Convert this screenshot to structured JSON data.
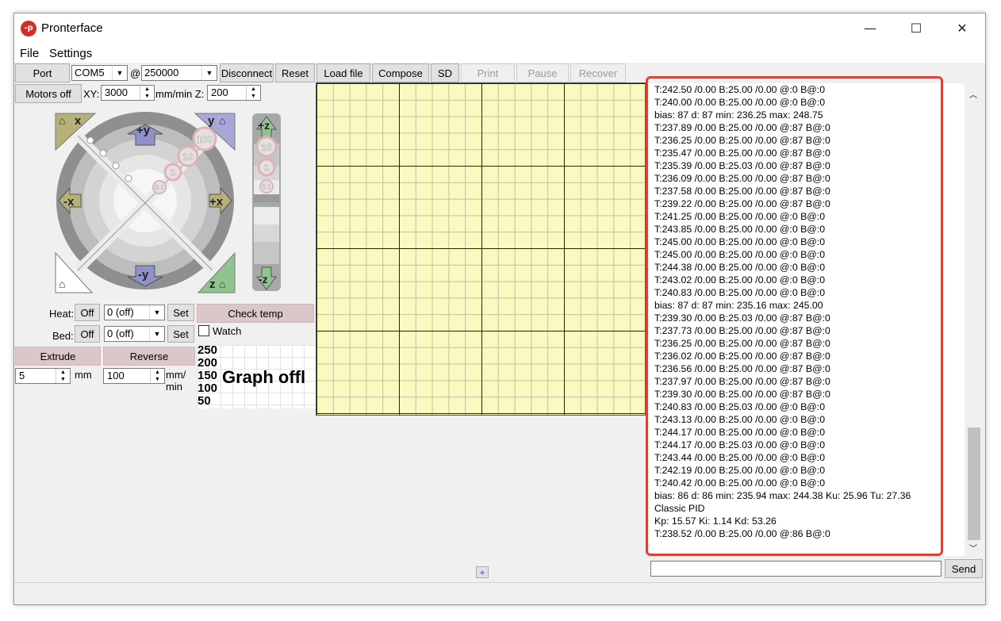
{
  "window": {
    "title": "Pronterface",
    "minimize": "—",
    "maximize": "☐",
    "close": "✕"
  },
  "menu": [
    "File",
    "Settings"
  ],
  "toolbar": {
    "port": "Port",
    "port_value": "COM5",
    "at": "@",
    "baud_value": "250000",
    "disconnect": "Disconnect",
    "reset": "Reset",
    "load_file": "Load file",
    "compose": "Compose",
    "sd": "SD",
    "print": "Print",
    "pause": "Pause",
    "recover": "Recover"
  },
  "motion": {
    "motors_off": "Motors off",
    "xy_label": "XY:",
    "xy_value": "3000",
    "mm_min_label": "mm/min Z:",
    "z_value": "200",
    "jog_labels": {
      "plus_y": "+y",
      "minus_y": "-y",
      "plus_x": "+x",
      "minus_x": "-x",
      "home_x": "x",
      "home_y": "y",
      "home_z": "z",
      "step100": "100",
      "step10": "10",
      "step1": "1",
      "step01": "0.1",
      "plus_z": "+z",
      "minus_z": "-z",
      "z10": "10",
      "z1": "1",
      "z01": "0.1"
    }
  },
  "temperature": {
    "heat_label": "Heat:",
    "bed_label": "Bed:",
    "off": "Off",
    "set": "Set",
    "heat_value": "0 (off)",
    "bed_value": "0 (off)",
    "check_temp": "Check temp",
    "watch": "Watch"
  },
  "extrude": {
    "extrude": "Extrude",
    "reverse": "Reverse",
    "length_value": "5",
    "length_unit": "mm",
    "speed_value": "100",
    "speed_unit": "mm/\nmin"
  },
  "graph": {
    "ticks": [
      "250",
      "200",
      "150",
      "100",
      "50"
    ],
    "message": "Graph offl"
  },
  "console": {
    "send": "Send",
    "input_value": "",
    "lines": [
      "T:242.50 /0.00 B:25.00 /0.00 @:0 B@:0",
      "T:240.00 /0.00 B:25.00 /0.00 @:0 B@:0",
      "bias: 87 d: 87 min: 236.25 max: 248.75",
      "T:237.89 /0.00 B:25.00 /0.00 @:87 B@:0",
      "T:236.25 /0.00 B:25.00 /0.00 @:87 B@:0",
      "T:235.47 /0.00 B:25.00 /0.00 @:87 B@:0",
      "T:235.39 /0.00 B:25.03 /0.00 @:87 B@:0",
      "T:236.09 /0.00 B:25.00 /0.00 @:87 B@:0",
      "T:237.58 /0.00 B:25.00 /0.00 @:87 B@:0",
      "T:239.22 /0.00 B:25.00 /0.00 @:87 B@:0",
      "T:241.25 /0.00 B:25.00 /0.00 @:0 B@:0",
      "T:243.85 /0.00 B:25.00 /0.00 @:0 B@:0",
      "T:245.00 /0.00 B:25.00 /0.00 @:0 B@:0",
      "T:245.00 /0.00 B:25.00 /0.00 @:0 B@:0",
      "T:244.38 /0.00 B:25.00 /0.00 @:0 B@:0",
      "T:243.02 /0.00 B:25.00 /0.00 @:0 B@:0",
      "T:240.83 /0.00 B:25.00 /0.00 @:0 B@:0",
      "bias: 87 d: 87 min: 235.16 max: 245.00",
      "T:239.30 /0.00 B:25.03 /0.00 @:87 B@:0",
      "T:237.73 /0.00 B:25.00 /0.00 @:87 B@:0",
      "T:236.25 /0.00 B:25.00 /0.00 @:87 B@:0",
      "T:236.02 /0.00 B:25.00 /0.00 @:87 B@:0",
      "T:236.56 /0.00 B:25.00 /0.00 @:87 B@:0",
      "T:237.97 /0.00 B:25.00 /0.00 @:87 B@:0",
      "T:239.30 /0.00 B:25.00 /0.00 @:87 B@:0",
      "T:240.83 /0.00 B:25.03 /0.00 @:0 B@:0",
      "T:243.13 /0.00 B:25.00 /0.00 @:0 B@:0",
      "T:244.17 /0.00 B:25.00 /0.00 @:0 B@:0",
      "T:244.17 /0.00 B:25.03 /0.00 @:0 B@:0",
      "T:243.44 /0.00 B:25.00 /0.00 @:0 B@:0",
      "T:242.19 /0.00 B:25.00 /0.00 @:0 B@:0",
      "T:240.42 /0.00 B:25.00 /0.00 @:0 B@:0",
      "bias: 86 d: 86 min: 235.94 max: 244.38 Ku: 25.96 Tu: 27.36",
      "Classic PID",
      "Kp: 15.57 Ki: 1.14 Kd: 53.26",
      "T:238.52 /0.00 B:25.00 /0.00 @:86 B@:0"
    ]
  },
  "misc": {
    "expand": "+"
  },
  "colors": {
    "plate": "#fafac0",
    "highlight": "#d9433a",
    "pink_button": "#dcc7c8"
  }
}
